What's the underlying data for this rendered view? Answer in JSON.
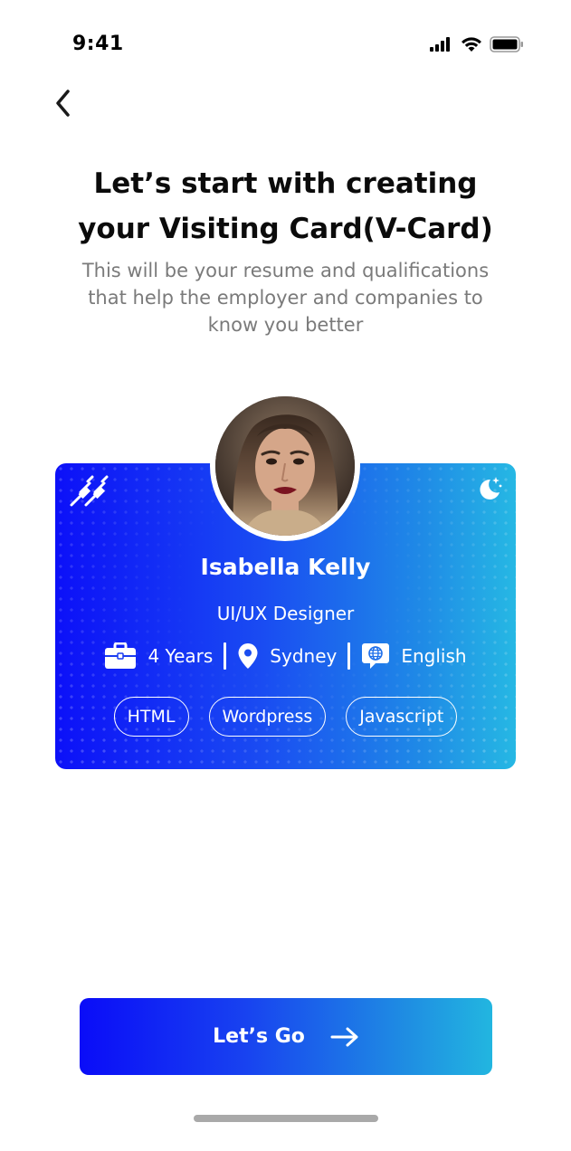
{
  "status_bar": {
    "time": "9:41",
    "icons": [
      "signal-icon",
      "wifi-icon",
      "battery-icon"
    ]
  },
  "header": {
    "back_icon": "chevron-left-icon"
  },
  "intro": {
    "title_line1": "Let’s start with creating",
    "title_line2": "your Visiting Card(V-Card)",
    "subtitle_line1": "This will be your resume and qualifications",
    "subtitle_line2": "that help the employer and companies to",
    "subtitle_line3": "know you better"
  },
  "vcard": {
    "name": "Isabella Kelly",
    "role": "UI/UX Designer",
    "experience": "4 Years",
    "location": "Sydney",
    "language": "English",
    "tags": [
      "HTML",
      "Wordpress",
      "Javascript"
    ],
    "left_icon": "tools-icon",
    "right_icon": "moon-icon",
    "colors": {
      "gradient_start": "#0c10f8",
      "gradient_end": "#26b8e4"
    }
  },
  "cta": {
    "label": "Let’s Go",
    "icon": "arrow-right-icon"
  }
}
